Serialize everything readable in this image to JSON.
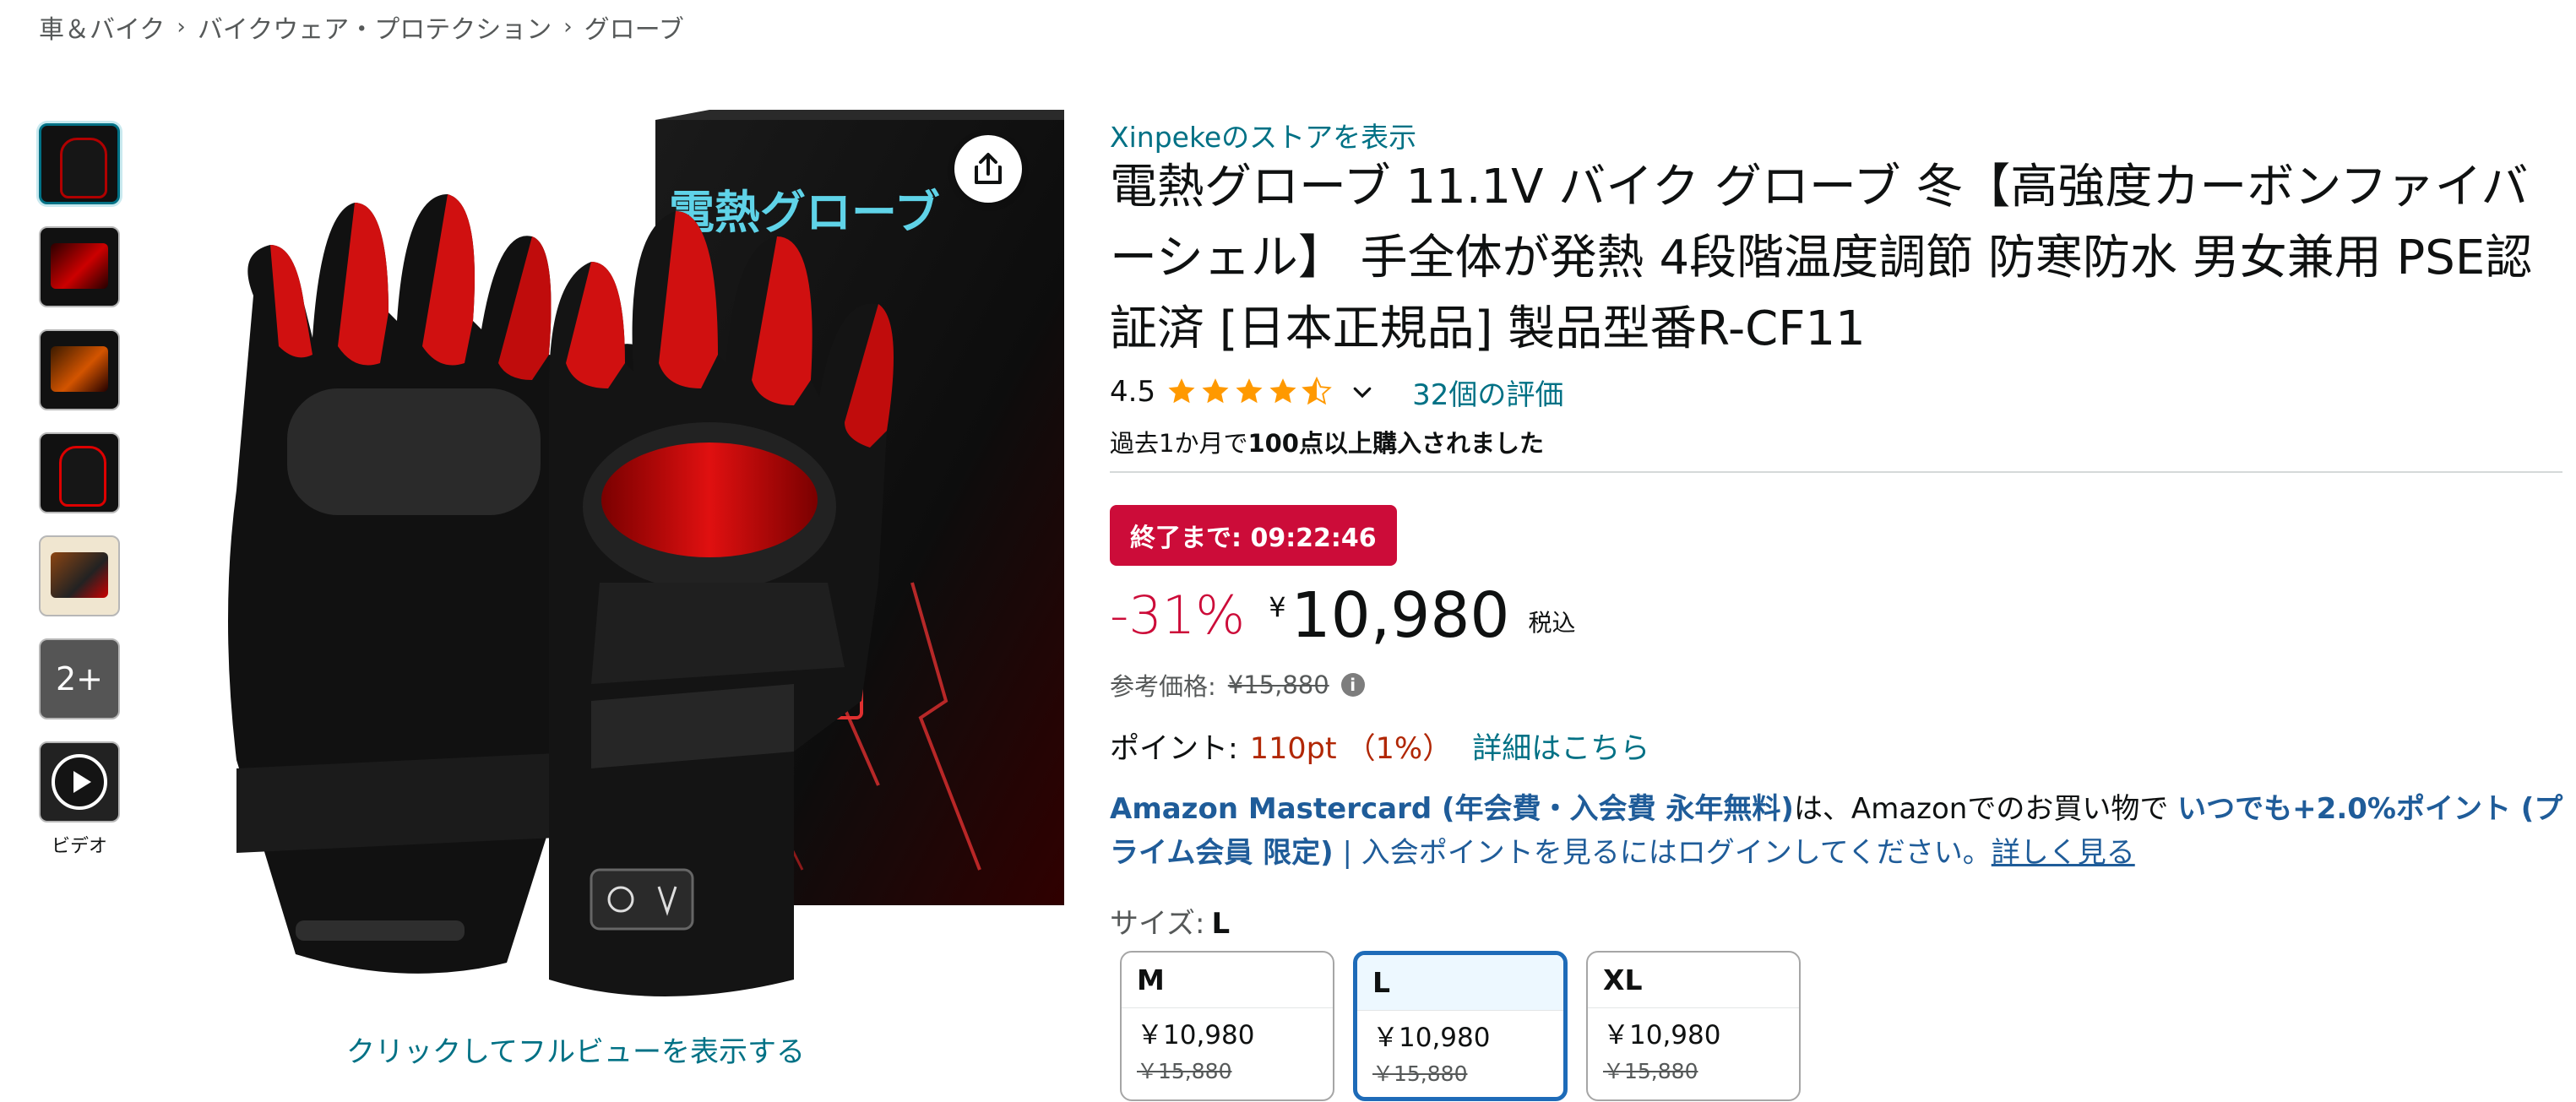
{
  "breadcrumb": [
    "車＆バイク",
    "バイクウェア・プロテクション",
    "グローブ"
  ],
  "breadcrumb_separator": "›",
  "gallery": {
    "more_label": "2+",
    "video_label": "ビデオ",
    "fullview_label": "クリックしてフルビューを表示する",
    "box_text": "電熱グローブ"
  },
  "product": {
    "store_link": "Xinpekeのストアを表示",
    "title": "電熱グローブ 11.1V バイク グローブ 冬【高強度カーボンファイバーシェル】 手全体が発熱 4段階温度調節 防寒防水 男女兼用 PSE認証済 [日本正規品] 製品型番R-CF11",
    "rating": "4.5",
    "rating_count": "32個の評価",
    "bought_prefix": "過去1か月で",
    "bought_strong": "100点以上購入されました"
  },
  "pricing": {
    "deal_timer": "終了まで: 09:22:46",
    "discount": "-31%",
    "currency": "¥",
    "price": "10,980",
    "tax_label": "税込",
    "ref_label": "参考価格:",
    "ref_price": "¥15,880",
    "points_label": "ポイント:",
    "points_value": "110pt （1%）",
    "points_link": "詳細はこちら"
  },
  "mastercard": {
    "brand": "Amazon Mastercard (年会費・入会費 永年無料)",
    "mid": "は、Amazonでのお買い物で",
    "highlight": "いつでも+2.0%ポイント (プライム会員 限定)",
    "tail": " | 入会ポイントを見るにはログインしてください。",
    "link": "詳しく見る"
  },
  "size": {
    "label": "サイズ:",
    "selected": "L",
    "options": [
      {
        "name": "M",
        "price": "￥10,980",
        "orig": "￥15,880"
      },
      {
        "name": "L",
        "price": "￥10,980",
        "orig": "￥15,880"
      },
      {
        "name": "XL",
        "price": "￥10,980",
        "orig": "￥15,880"
      }
    ]
  },
  "colors": {
    "link": "#007185",
    "deal_red": "#cc0c39",
    "star": "#ff9900",
    "selected_border": "#1e6bb8"
  }
}
